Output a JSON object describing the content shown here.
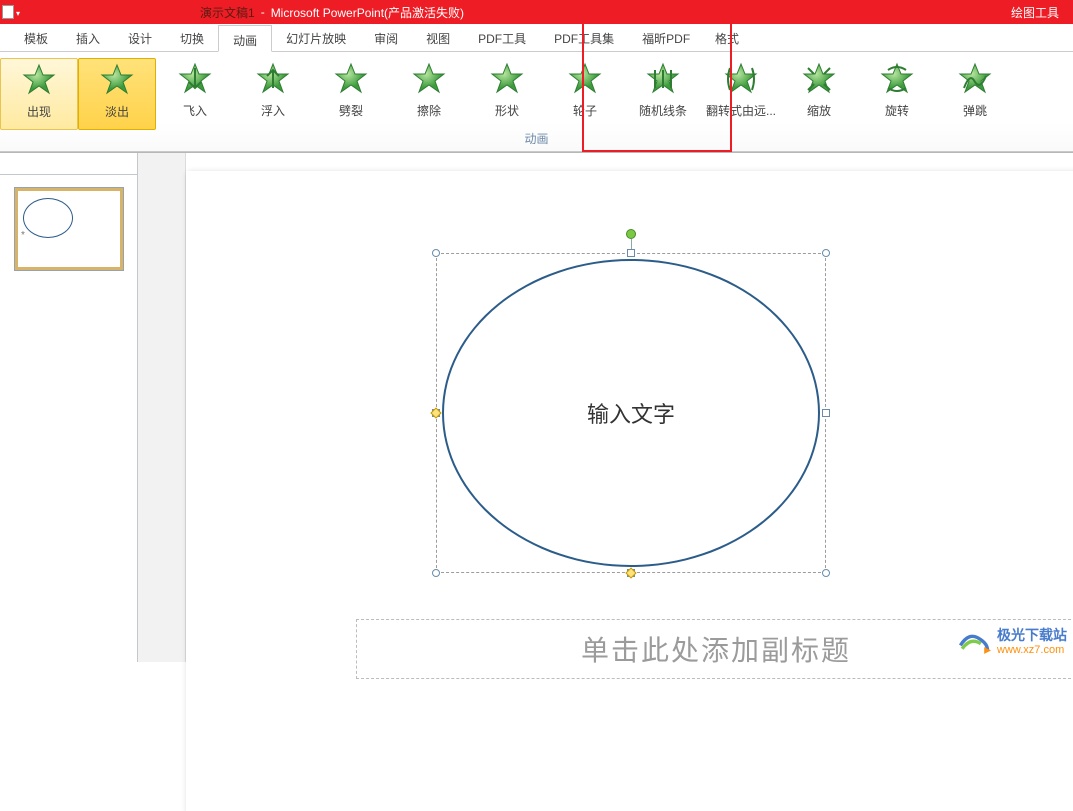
{
  "title": {
    "document": "演示文稿1",
    "sep": "-",
    "app": "Microsoft PowerPoint(产品激活失败)",
    "tools_tab": "绘图工具"
  },
  "tabs": {
    "template": "模板",
    "insert": "插入",
    "design": "设计",
    "transition": "切换",
    "animation": "动画",
    "slideshow": "幻灯片放映",
    "review": "审阅",
    "view": "视图",
    "pdf_tool": "PDF工具",
    "pdf_toolset": "PDF工具集",
    "foxit_pdf": "福昕PDF",
    "format": "格式"
  },
  "ribbon": {
    "group_label": "动画",
    "items": [
      {
        "key": "appear",
        "label": "出现"
      },
      {
        "key": "fade",
        "label": "淡出"
      },
      {
        "key": "flyin",
        "label": "飞入"
      },
      {
        "key": "floatin",
        "label": "浮入"
      },
      {
        "key": "split",
        "label": "劈裂"
      },
      {
        "key": "wipe",
        "label": "擦除"
      },
      {
        "key": "shape",
        "label": "形状"
      },
      {
        "key": "wheel",
        "label": "轮子"
      },
      {
        "key": "randombars",
        "label": "随机线条"
      },
      {
        "key": "growturn",
        "label": "翻转式由远..."
      },
      {
        "key": "zoom",
        "label": "缩放"
      },
      {
        "key": "swivel",
        "label": "旋转"
      },
      {
        "key": "bounce",
        "label": "弹跳"
      }
    ]
  },
  "slide": {
    "shape_text": "输入文字",
    "subtitle_placeholder": "单击此处添加副标题"
  },
  "thumbnail": {
    "anim_badge": "*"
  },
  "watermark": {
    "cn": "极光下载站",
    "url": "www.xz7.com"
  }
}
